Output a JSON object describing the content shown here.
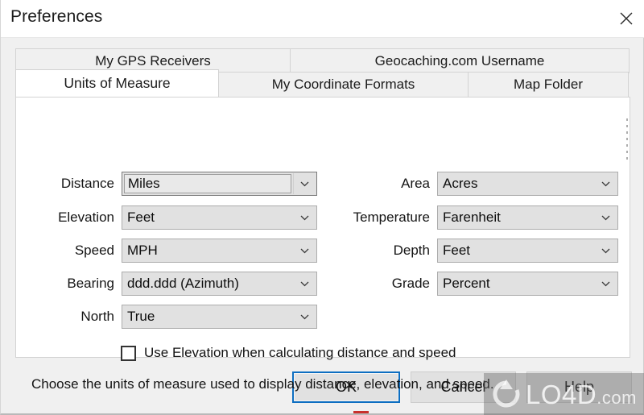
{
  "window": {
    "title": "Preferences",
    "close_icon": "close-icon"
  },
  "tabs": {
    "top_row": [
      {
        "label": "My GPS Receivers",
        "active": false
      },
      {
        "label": "Geocaching.com Username",
        "active": false
      }
    ],
    "bottom_row": [
      {
        "label": "Units of Measure",
        "active": true
      },
      {
        "label": "My Coordinate Formats",
        "active": false
      },
      {
        "label": "Map Folder",
        "active": false
      }
    ]
  },
  "form": {
    "left_column": [
      {
        "label": "Distance",
        "value": "Miles",
        "focused": true
      },
      {
        "label": "Elevation",
        "value": "Feet",
        "focused": false
      },
      {
        "label": "Speed",
        "value": "MPH",
        "focused": false
      },
      {
        "label": "Bearing",
        "value": "ddd.ddd (Azimuth)",
        "focused": false
      },
      {
        "label": "North",
        "value": "True",
        "focused": false
      }
    ],
    "right_column": [
      {
        "label": "Area",
        "value": "Acres",
        "focused": false
      },
      {
        "label": "Temperature",
        "value": "Farenheit",
        "focused": false
      },
      {
        "label": "Depth",
        "value": "Feet",
        "focused": false
      },
      {
        "label": "Grade",
        "value": "Percent",
        "focused": false
      }
    ],
    "checkbox": {
      "label": "Use Elevation when calculating distance and speed",
      "checked": false
    },
    "description": "Choose the units of measure used to display distance, elevation, and speed."
  },
  "buttons": {
    "ok": "OK",
    "cancel": "Cancel",
    "help": "Help"
  },
  "watermark": {
    "text": "LO4D",
    "suffix": ".com",
    "icon": "refresh-icon"
  },
  "colors": {
    "dialog_background": "#f0f0f0",
    "titlebar_background": "#ffffff",
    "panel_background": "#ffffff",
    "tab_inactive": "#f0f0f0",
    "control_face": "#e1e1e1",
    "control_border": "#acacac",
    "focus_blue": "#0d6ec1",
    "text": "#131313",
    "accent_red": "#c9302c"
  }
}
